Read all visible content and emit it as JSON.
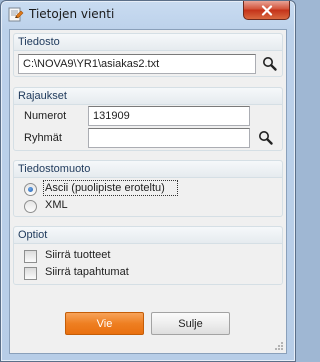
{
  "window": {
    "title": "Tietojen vienti"
  },
  "file_group": {
    "header": "Tiedosto",
    "path_value": "C:\\NOVA9\\YR1\\asiakas2.txt"
  },
  "limits_group": {
    "header": "Rajaukset",
    "number_label": "Numerot",
    "number_value": "131909",
    "groups_label": "Ryhmät",
    "groups_value": ""
  },
  "format_group": {
    "header": "Tiedostomuoto",
    "options": [
      {
        "label": "Ascii (puolipiste eroteltu)",
        "selected": true
      },
      {
        "label": "XML",
        "selected": false
      }
    ]
  },
  "options_group": {
    "header": "Optiot",
    "checks": [
      {
        "label": "Siirrä tuotteet",
        "checked": false
      },
      {
        "label": "Siirrä tapahtumat",
        "checked": false
      }
    ]
  },
  "buttons": {
    "primary": "Vie",
    "secondary": "Sulje"
  },
  "icons": {
    "search": "magnifier-icon",
    "close": "close-x-icon",
    "app": "export-app-icon"
  },
  "colors": {
    "primary_button": "#ee7f22",
    "group_header_text": "#1e395b",
    "close_button": "#c43219"
  }
}
